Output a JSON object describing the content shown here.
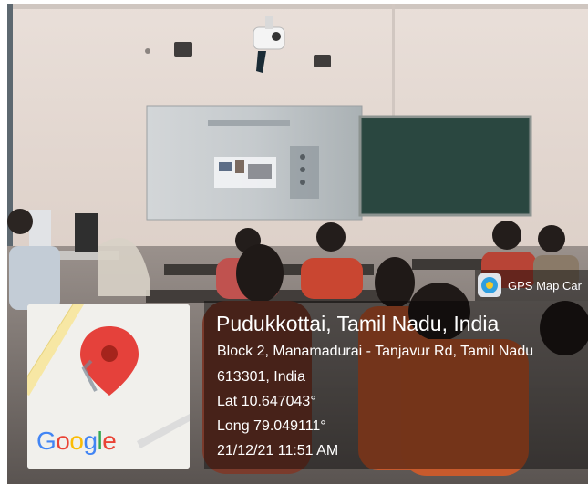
{
  "scene": {
    "description_tags": [
      "classroom",
      "projector-screen",
      "chalkboard",
      "students",
      "desktop-computer"
    ]
  },
  "app_badge": {
    "label": "GPS Map Car",
    "icon": "gps-map-camera-app-icon"
  },
  "location": {
    "title": "Pudukkottai, Tamil Nadu, India",
    "address_line1": "Block 2, Manamadurai - Tanjavur Rd, Tamil Nadu",
    "address_line2": "613301, India",
    "lat": "Lat 10.647043°",
    "long": "Long 79.049111°",
    "datetime": "21/12/21 11:51 AM"
  },
  "map": {
    "logo_letters": [
      "G",
      "o",
      "o",
      "g",
      "l",
      "e"
    ],
    "logo_colors": [
      "#4285F4",
      "#EA4335",
      "#FBBC05",
      "#4285F4",
      "#34A853",
      "#EA4335"
    ],
    "pin_color": "#E5413B",
    "icon": "map-pin-icon"
  }
}
